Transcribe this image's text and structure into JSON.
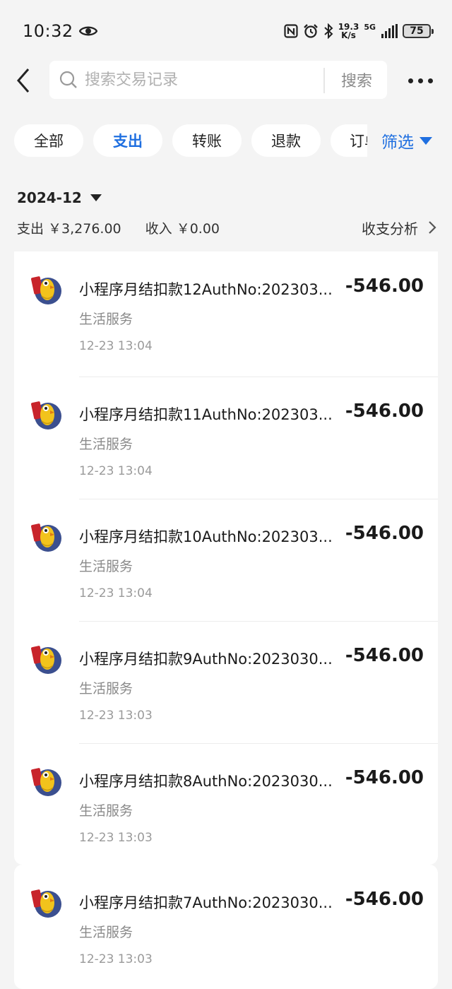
{
  "status": {
    "time": "10:32",
    "speed_top": "19.3",
    "speed_bottom": "K/s",
    "network": "5G",
    "battery": "75"
  },
  "search": {
    "placeholder": "搜索交易记录",
    "button": "搜索"
  },
  "filters": {
    "chips": [
      "全部",
      "支出",
      "转账",
      "退款",
      "订单"
    ],
    "active_index": 1,
    "filter_label": "筛选"
  },
  "summary": {
    "month": "2024-12",
    "expense": "支出 ￥3,276.00",
    "income": "收入 ￥0.00",
    "analysis": "收支分析"
  },
  "transactions": [
    {
      "title": "小程序月结扣款12AuthNo:202303...",
      "category": "生活服务",
      "time": "12-23 13:04",
      "amount": "-546.00"
    },
    {
      "title": "小程序月结扣款11AuthNo:202303...",
      "category": "生活服务",
      "time": "12-23 13:04",
      "amount": "-546.00"
    },
    {
      "title": "小程序月结扣款10AuthNo:202303...",
      "category": "生活服务",
      "time": "12-23 13:04",
      "amount": "-546.00"
    },
    {
      "title": "小程序月结扣款9AuthNo:2023030...",
      "category": "生活服务",
      "time": "12-23 13:03",
      "amount": "-546.00"
    },
    {
      "title": "小程序月结扣款8AuthNo:2023030...",
      "category": "生活服务",
      "time": "12-23 13:03",
      "amount": "-546.00"
    },
    {
      "title": "小程序月结扣款7AuthNo:2023030...",
      "category": "生活服务",
      "time": "12-23 13:03",
      "amount": "-546.00"
    }
  ],
  "colors": {
    "accent": "#1f6fe0",
    "background": "#f4f4f4",
    "card": "#ffffff"
  }
}
